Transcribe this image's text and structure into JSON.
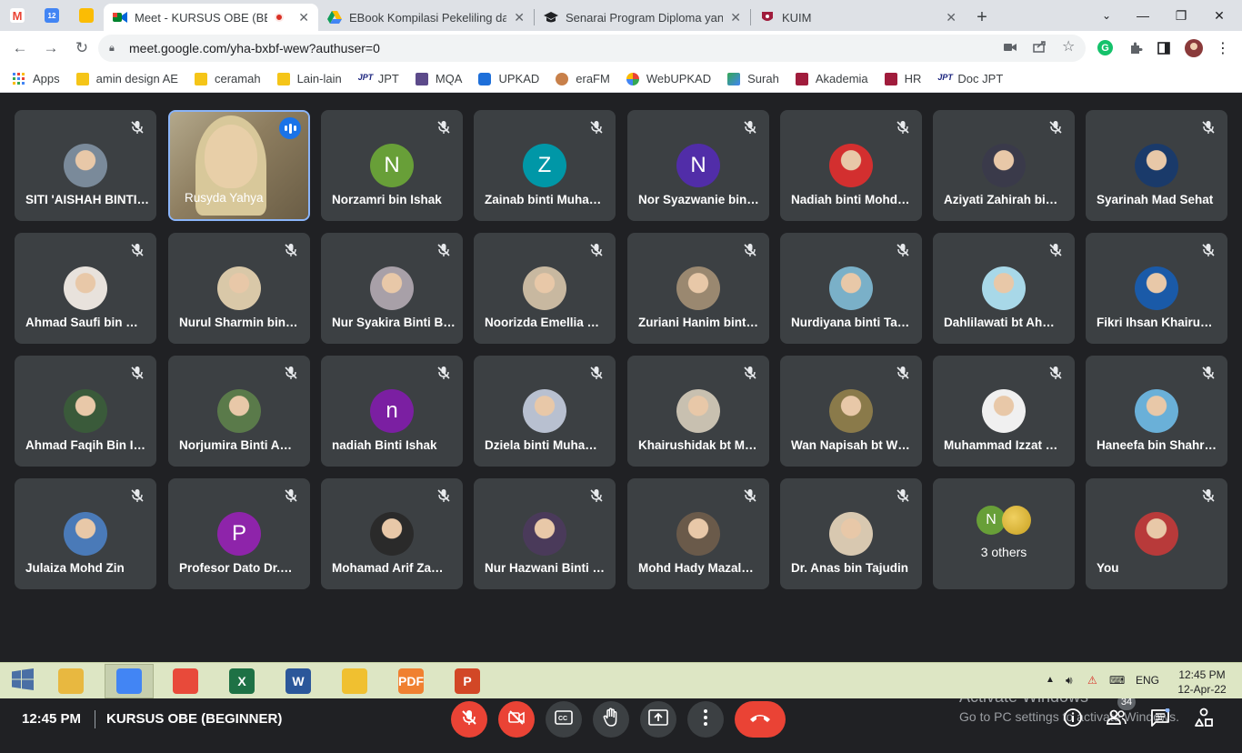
{
  "browser": {
    "pinned_tabs": [
      {
        "icon": "gmail-icon",
        "letter": "M",
        "color": "#ea4335"
      },
      {
        "icon": "calendar-icon",
        "letter": "12",
        "color": "#4285f4"
      },
      {
        "icon": "keep-icon",
        "letter": "",
        "color": "#fbbc04"
      }
    ],
    "tabs": [
      {
        "title": "Meet - KURSUS OBE (BEGI",
        "icon": "meet-icon",
        "active": true,
        "recording": true
      },
      {
        "title": "EBook Kompilasi Pekeliling dan",
        "icon": "drive-icon",
        "active": false
      },
      {
        "title": "Senarai Program Diploma yang",
        "icon": "graduation-cap-icon",
        "active": false
      },
      {
        "title": "KUIM",
        "icon": "kuim-icon",
        "active": false
      }
    ],
    "close_glyph": "✕",
    "new_tab_glyph": "+",
    "url": "meet.google.com/yha-bxbf-wew?authuser=0",
    "bookmarks": [
      {
        "label": "Apps",
        "icon": "apps-grid-icon"
      },
      {
        "label": "amin design AE",
        "icon": "folder-icon"
      },
      {
        "label": "ceramah",
        "icon": "folder-icon"
      },
      {
        "label": "Lain-lain",
        "icon": "folder-icon"
      },
      {
        "label": "JPT",
        "icon": "jpt-icon"
      },
      {
        "label": "MQA",
        "icon": "mqa-icon"
      },
      {
        "label": "UPKAD",
        "icon": "upkad-icon"
      },
      {
        "label": "eraFM",
        "icon": "erafm-icon"
      },
      {
        "label": "WebUPKAD",
        "icon": "webupkad-icon"
      },
      {
        "label": "Surah",
        "icon": "surah-icon"
      },
      {
        "label": "Akademia",
        "icon": "kuim-icon"
      },
      {
        "label": "HR",
        "icon": "kuim-icon"
      },
      {
        "label": "Doc JPT",
        "icon": "jpt-icon"
      }
    ]
  },
  "participants": [
    {
      "name": "SITI 'AISHAH BINTI…",
      "avatar": "photo",
      "color": "#7a8a9a"
    },
    {
      "name": "Rusyda Yahya",
      "avatar": "video",
      "speaking": true
    },
    {
      "name": "Norzamri bin Ishak",
      "avatar": "letter",
      "letter": "N",
      "color": "#689f38"
    },
    {
      "name": "Zainab binti Muha…",
      "avatar": "letter",
      "letter": "Z",
      "color": "#0097a7"
    },
    {
      "name": "Nor Syazwanie bin…",
      "avatar": "letter",
      "letter": "N",
      "color": "#512da8"
    },
    {
      "name": "Nadiah binti Mohd…",
      "avatar": "photo",
      "color": "#d32f2f"
    },
    {
      "name": "Aziyati Zahirah bi…",
      "avatar": "photo",
      "color": "#3a3a4a"
    },
    {
      "name": "Syarinah Mad Sehat",
      "avatar": "photo",
      "color": "#1a3a6a"
    },
    {
      "name": "Ahmad Saufi bin …",
      "avatar": "photo",
      "color": "#e8e2dc"
    },
    {
      "name": "Nurul Sharmin bin…",
      "avatar": "photo",
      "color": "#d9c8a8"
    },
    {
      "name": "Nur Syakira Binti B…",
      "avatar": "photo",
      "color": "#a8a0a8"
    },
    {
      "name": "Noorizda Emellia …",
      "avatar": "photo",
      "color": "#c8b8a0"
    },
    {
      "name": "Zuriani Hanim bint…",
      "avatar": "photo",
      "color": "#9a8870"
    },
    {
      "name": "Nurdiyana binti Ta…",
      "avatar": "photo",
      "color": "#7ab0c8"
    },
    {
      "name": "Dahlilawati bt Ah…",
      "avatar": "photo",
      "color": "#a8d8e8"
    },
    {
      "name": "Fikri Ihsan Khairu…",
      "avatar": "photo",
      "color": "#1a5aa8"
    },
    {
      "name": "Ahmad Faqih Bin I…",
      "avatar": "photo",
      "color": "#3a5a3a"
    },
    {
      "name": "Norjumira Binti A…",
      "avatar": "photo",
      "color": "#5a7a4a"
    },
    {
      "name": "nadiah Binti Ishak",
      "avatar": "letter",
      "letter": "n",
      "color": "#7b1fa2"
    },
    {
      "name": "Dziela binti Muha…",
      "avatar": "photo",
      "color": "#b8c0d0"
    },
    {
      "name": "Khairushidak bt M…",
      "avatar": "photo",
      "color": "#c8c0b0"
    },
    {
      "name": "Wan Napisah bt W…",
      "avatar": "photo",
      "color": "#8a7a4a"
    },
    {
      "name": "Muhammad Izzat …",
      "avatar": "photo",
      "color": "#f0f0f0"
    },
    {
      "name": "Haneefa bin Shahr…",
      "avatar": "photo",
      "color": "#6ab0d8"
    },
    {
      "name": "Julaiza Mohd Zin",
      "avatar": "photo",
      "color": "#4a7ab8"
    },
    {
      "name": "Profesor Dato Dr.…",
      "avatar": "letter",
      "letter": "P",
      "color": "#8e24aa"
    },
    {
      "name": "Mohamad Arif Za…",
      "avatar": "photo",
      "color": "#2a2a2a"
    },
    {
      "name": "Nur Hazwani Binti …",
      "avatar": "photo",
      "color": "#4a3a5a"
    },
    {
      "name": "Mohd Hady Mazal…",
      "avatar": "photo",
      "color": "#6a5a4a"
    },
    {
      "name": "Dr. Anas bin Tajudin",
      "avatar": "photo",
      "color": "#d8c8b0"
    },
    {
      "name": "3 others",
      "avatar": "others",
      "others_letter": "N",
      "others_color": "#689f38",
      "others_color2": "#c8a020"
    },
    {
      "name": "You",
      "avatar": "photo",
      "color": "#b83a3a"
    }
  ],
  "meeting": {
    "time": "12:45 PM",
    "title": "KURSUS OBE (BEGINNER)",
    "participant_count": "34",
    "activate_line1": "Activate Windows",
    "activate_line2": "Go to PC settings to activate Windows."
  },
  "controls": [
    {
      "name": "mic-off-button",
      "icon": "mic-off-icon",
      "style": "red"
    },
    {
      "name": "camera-off-button",
      "icon": "camera-off-icon",
      "style": "red"
    },
    {
      "name": "captions-button",
      "icon": "captions-icon",
      "style": "grey"
    },
    {
      "name": "raise-hand-button",
      "icon": "hand-icon",
      "style": "grey"
    },
    {
      "name": "present-button",
      "icon": "present-icon",
      "style": "grey"
    },
    {
      "name": "more-options-button",
      "icon": "more-vert-icon",
      "style": "grey"
    },
    {
      "name": "leave-call-button",
      "icon": "call-end-icon",
      "style": "end"
    }
  ],
  "taskbar": {
    "apps": [
      {
        "name": "file-explorer",
        "color": "#e8b840",
        "label": ""
      },
      {
        "name": "chrome",
        "color": "#4285f4",
        "label": "",
        "active": true
      },
      {
        "name": "app-red",
        "color": "#e84a3a",
        "label": ""
      },
      {
        "name": "excel",
        "color": "#1e7145",
        "label": "X"
      },
      {
        "name": "word",
        "color": "#2b579a",
        "label": "W"
      },
      {
        "name": "app-colorful",
        "color": "#f0c030",
        "label": ""
      },
      {
        "name": "pdf-app",
        "color": "#f08030",
        "label": "PDF"
      },
      {
        "name": "powerpoint",
        "color": "#d24726",
        "label": "P"
      }
    ],
    "lang": "ENG",
    "time": "12:45 PM",
    "date": "12-Apr-22"
  },
  "colors": {
    "meet_bg": "#202124",
    "tile_bg": "#3c4043",
    "danger": "#ea4335",
    "speaking_border": "#8ab4f8"
  }
}
